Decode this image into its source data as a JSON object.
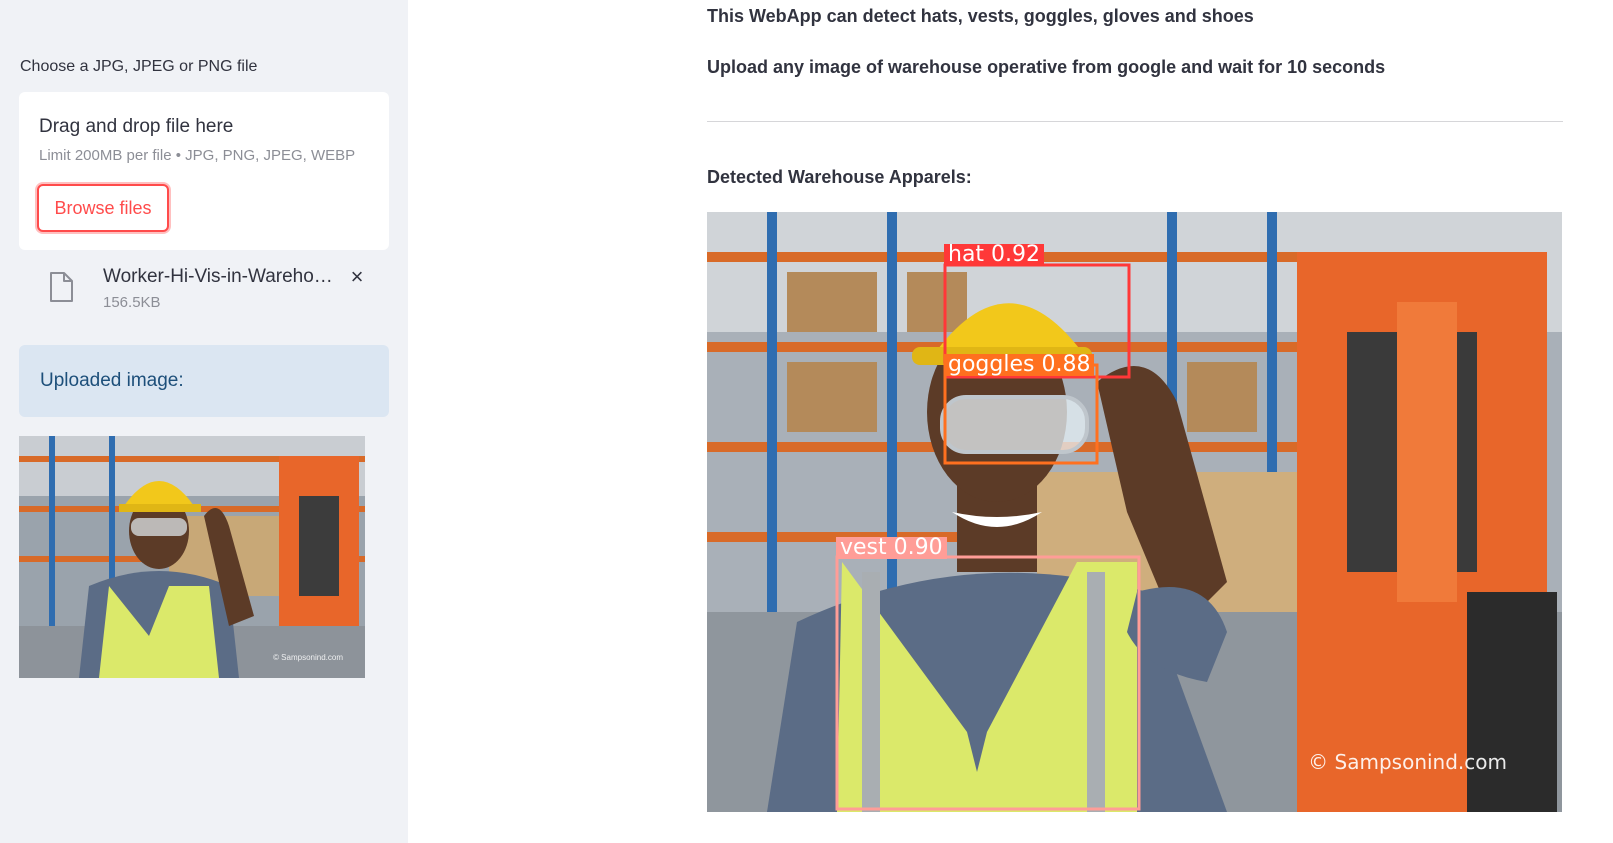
{
  "sidebar": {
    "uploader_label": "Choose a JPG, JPEG or PNG file",
    "dropzone": {
      "title": "Drag and drop file here",
      "limit": "Limit 200MB per file • JPG, PNG, JPEG, WEBP",
      "browse_label": "Browse files"
    },
    "file": {
      "name": "Worker-Hi-Vis-in-Warehous…",
      "size": "156.5KB",
      "close_icon": "×"
    },
    "info": "Uploaded image:",
    "thumbnail_watermark": "© Sampsonind.com"
  },
  "main": {
    "line1": "This WebApp can detect hats, vests, goggles, gloves and shoes",
    "line2": "Upload any image of warehouse operative from google and wait for 10 seconds",
    "detected_title": "Detected Warehouse Apparels:",
    "detections": [
      {
        "label": "hat  0.92",
        "color": "#ff3838"
      },
      {
        "label": "goggles  0.88",
        "color": "#ff701f"
      },
      {
        "label": "vest  0.90",
        "color": "#ff9d97"
      }
    ],
    "watermark": "© Sampsonind.com"
  },
  "colors": {
    "accent": "#ff4b4b",
    "sidebar_bg": "#f0f2f6",
    "info_bg": "#dbe6f2"
  }
}
